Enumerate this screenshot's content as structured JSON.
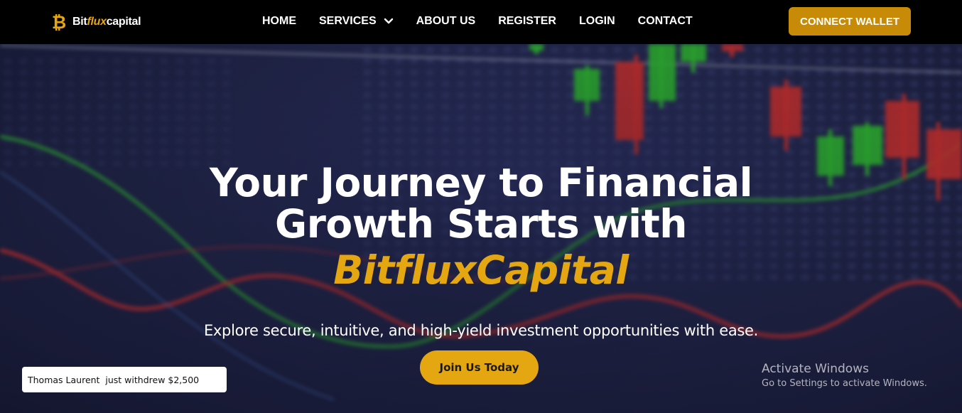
{
  "header": {
    "logo": {
      "prefix": "Bit",
      "accent": "flux",
      "suffix": "capital"
    },
    "nav": [
      {
        "label": "HOME"
      },
      {
        "label": "SERVICES",
        "has_dropdown": true
      },
      {
        "label": "ABOUT US"
      },
      {
        "label": "REGISTER"
      },
      {
        "label": "LOGIN"
      },
      {
        "label": "CONTACT"
      }
    ],
    "connect_label": "CONNECT WALLET"
  },
  "hero": {
    "title_line1": "Your Journey to Financial",
    "title_line2": "Growth Starts with",
    "brand": "BitfluxCapital",
    "subtitle": "Explore secure, intuitive, and high-yield investment opportunities with ease.",
    "cta_label": "Join Us Today"
  },
  "toast": {
    "text": "Thomas Laurent  just withdrew $2,500"
  },
  "windows_watermark": {
    "title": "Activate Windows",
    "subtitle": "Go to Settings to activate Windows."
  },
  "colors": {
    "accent": "#e5a711",
    "button_dark_gold": "#c78b08",
    "nav_bg": "#000000",
    "candle_green": "#2fb82f",
    "candle_red": "#c9302c"
  },
  "icons": {
    "logo": "bitcoin-icon",
    "dropdown": "chevron-down-icon"
  }
}
